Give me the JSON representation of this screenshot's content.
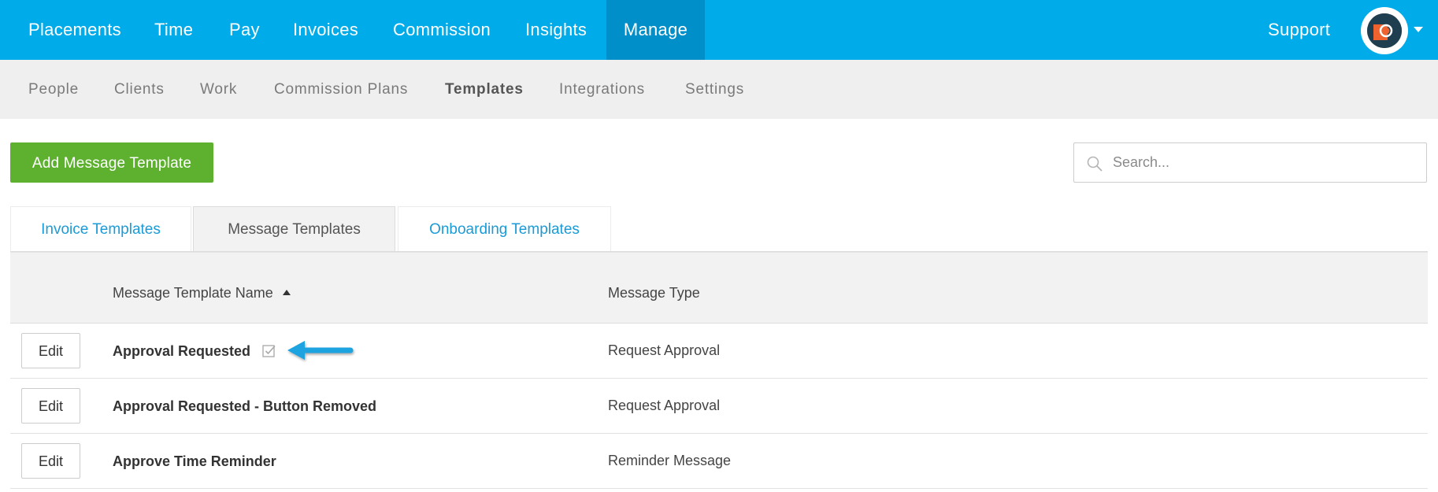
{
  "top_nav": {
    "items": [
      "Placements",
      "Time",
      "Pay",
      "Invoices",
      "Commission",
      "Insights",
      "Manage"
    ],
    "active": "Manage",
    "support_label": "Support",
    "accent_color": "#00abe9",
    "active_color": "#008fc9"
  },
  "sub_nav": {
    "items": [
      "People",
      "Clients",
      "Work",
      "Commission Plans",
      "Templates",
      "Integrations",
      "Settings"
    ],
    "active": "Templates"
  },
  "toolbar": {
    "add_button_label": "Add Message Template",
    "add_button_color": "#5db12f",
    "search_placeholder": "Search..."
  },
  "tabs": {
    "items": [
      "Invoice Templates",
      "Message Templates",
      "Onboarding Templates"
    ],
    "selected": "Message Templates"
  },
  "table": {
    "columns": [
      "Message Template Name",
      "Message Type"
    ],
    "sorted_column": "Message Template Name",
    "sort_direction": "ascending",
    "edit_label": "Edit",
    "rows": [
      {
        "name": "Approval Requested",
        "type": "Request Approval",
        "default": true,
        "annotated": true
      },
      {
        "name": "Approval Requested - Button Removed",
        "type": "Request Approval",
        "default": false,
        "annotated": false
      },
      {
        "name": "Approve Time Reminder",
        "type": "Reminder Message",
        "default": false,
        "annotated": false
      }
    ]
  }
}
